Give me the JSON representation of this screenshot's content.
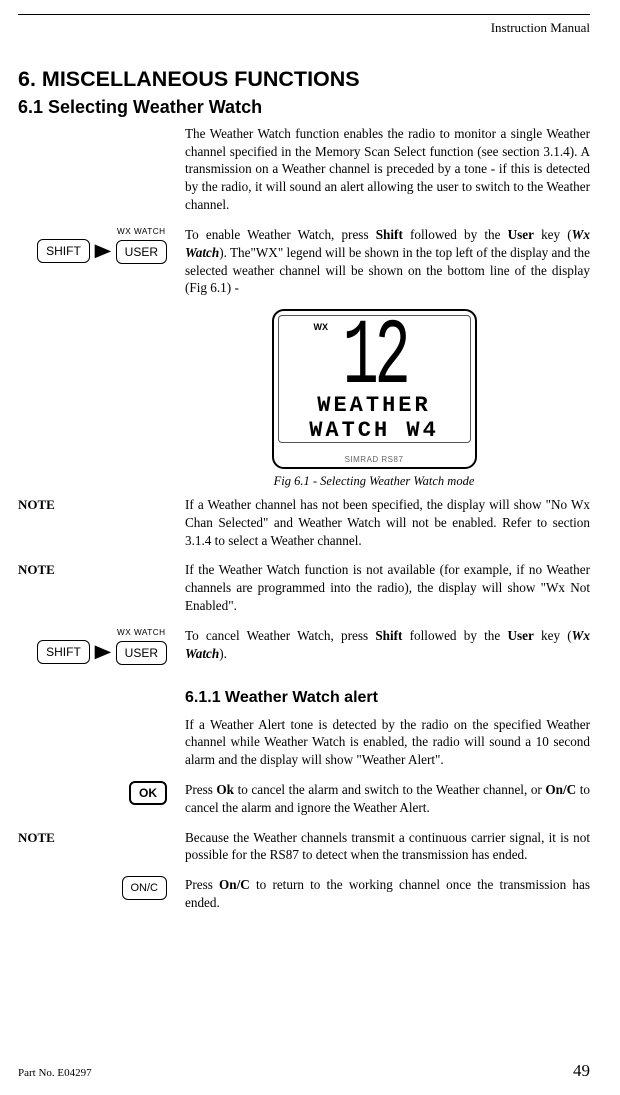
{
  "header": {
    "title": "Instruction Manual"
  },
  "headings": {
    "h1": "6.  MISCELLANEOUS FUNCTIONS",
    "h2": "6.1 Selecting Weather Watch",
    "h3": "6.1.1     Weather Watch alert"
  },
  "body": {
    "intro": "The Weather Watch function enables the radio to monitor a single Weather channel specified in the Memory Scan Select function (see section 3.1.4).  A transmission on a Weather channel is preceded by a tone - if this is detected by the radio, it will sound an alert allowing the user to switch to the Weather channel.",
    "enable_pre": "To enable Weather Watch, press ",
    "enable_shift": "Shift",
    "enable_mid": " followed by the ",
    "enable_user": "User",
    "enable_post1": " key (",
    "enable_italic": "Wx Watch",
    "enable_post2": ").  The\"WX\" legend will be shown in the top left of the display and the selected weather channel will be shown on the bottom line of the display (Fig 6.1) -",
    "fig_caption": "Fig 6.1 - Selecting Weather Watch mode",
    "note1": "If a Weather channel has not been specified, the display will show \"No Wx Chan Selected\" and Weather Watch will not be enabled.  Refer to section 3.1.4 to select a Weather channel.",
    "note2": "If the Weather Watch function is not available (for example, if no Weather channels are programmed into the radio), the display will show \"Wx Not Enabled\".",
    "cancel_pre": "To cancel Weather Watch, press ",
    "cancel_shift": "Shift",
    "cancel_mid": " followed by the ",
    "cancel_user": "User",
    "cancel_post1": " key (",
    "cancel_italic": "Wx Watch",
    "cancel_post2": ").",
    "alert_intro": "If a Weather Alert tone is detected by the radio on the specified Weather channel while Weather Watch is enabled, the radio will sound a 10 second alarm and the display will show \"Weather Alert\".",
    "ok_pre": "Press ",
    "ok_bold": "Ok",
    "ok_mid": " to cancel the alarm and switch to the Weather  channel, or ",
    "onc_bold": "On/C",
    "ok_post": " to cancel the alarm and ignore the Weather Alert.",
    "note3": "Because the Weather channels transmit a continuous carrier signal, it is not possible for the RS87 to detect when the transmission has ended.",
    "onc_final_pre": "Press ",
    "onc_final_bold": "On/C",
    "onc_final_post": " to return to the working channel once the transmission has ended."
  },
  "labels": {
    "note": "NOTE",
    "shift": "SHIFT",
    "user": "USER",
    "wx_watch": "WX WATCH",
    "ok": "OK",
    "onc": "ON/C"
  },
  "lcd": {
    "wx": "WX",
    "big": "12",
    "line1": "WEATHER",
    "line2": "WATCH   W4",
    "brand": "SIMRAD RS87"
  },
  "footer": {
    "part": "Part No. E04297",
    "page": "49"
  }
}
